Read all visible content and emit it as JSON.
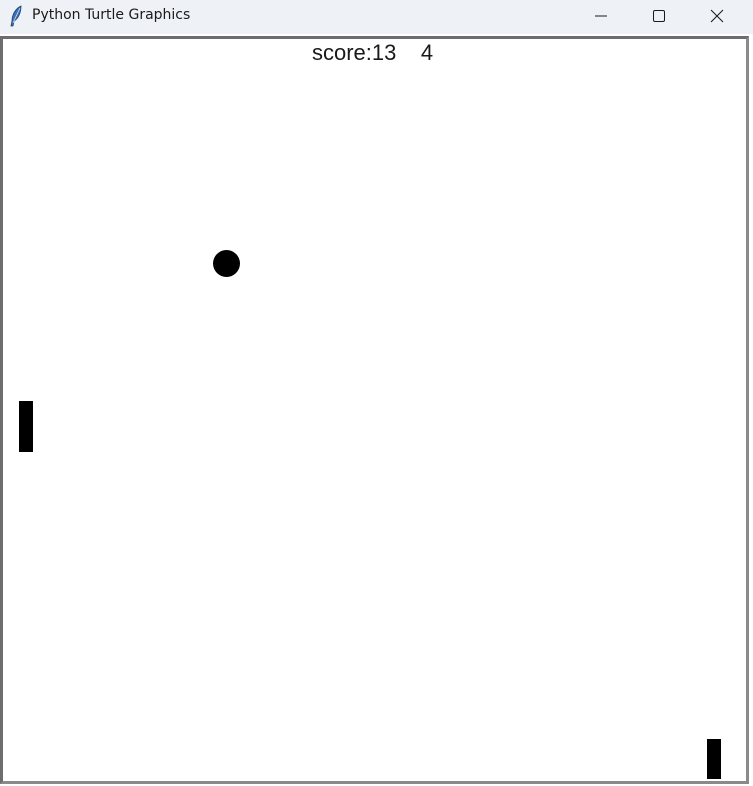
{
  "window": {
    "title": "Python Turtle Graphics",
    "app_icon": "feather-icon",
    "controls": [
      "minimize-icon",
      "maximize-icon",
      "close-icon"
    ]
  },
  "game": {
    "score_label": "score:13    4",
    "ball_color": "#000000",
    "paddle_color": "#000000",
    "background_color": "#ffffff"
  }
}
